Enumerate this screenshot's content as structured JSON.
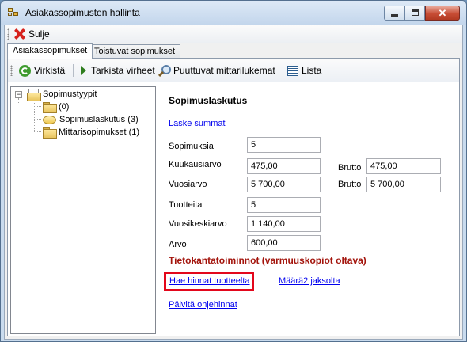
{
  "window": {
    "title": "Asiakassopimusten hallinta"
  },
  "toolbar": {
    "close_label": "Sulje"
  },
  "tabs": [
    {
      "label": "Asiakassopimukset"
    },
    {
      "label": "Toistuvat sopimukset"
    }
  ],
  "actions": {
    "refresh": "Virkistä",
    "check_errors": "Tarkista virheet",
    "missing_readings": "Puuttuvat mittarilukemat",
    "list": "Lista"
  },
  "tree": {
    "root": "Sopimustyypit",
    "items": [
      {
        "label": "(0)"
      },
      {
        "label": "Sopimuslaskutus (3)"
      },
      {
        "label": "Mittarisopimukset (1)"
      }
    ]
  },
  "details": {
    "heading": "Sopimuslaskutus",
    "calc_link": "Laske summat",
    "fields": {
      "count": {
        "label": "Sopimuksia",
        "value": "5"
      },
      "monthly": {
        "label": "Kuukausiarvo",
        "value": "475,00",
        "gross_label": "Brutto",
        "gross_value": "475,00"
      },
      "yearly": {
        "label": "Vuosiarvo",
        "value": "5 700,00",
        "gross_label": "Brutto",
        "gross_value": "5 700,00"
      },
      "products": {
        "label": "Tuotteita",
        "value": "5"
      },
      "year_avg": {
        "label": "Vuosikeskiarvo",
        "value": "1 140,00"
      },
      "value": {
        "label": "Arvo",
        "value": "600,00"
      }
    },
    "db_heading": "Tietokantatoiminnot (varmuuskopiot oltava)",
    "db_links": {
      "fetch_prices": "Hae hinnat tuotteelta",
      "qty_period": "Määrä2 jaksolta",
      "update_prices": "Päivitä ohjehinnat"
    }
  },
  "colors": {
    "db_heading": "#a3140c",
    "highlight": "#e3071b",
    "link": "#0000ee"
  }
}
